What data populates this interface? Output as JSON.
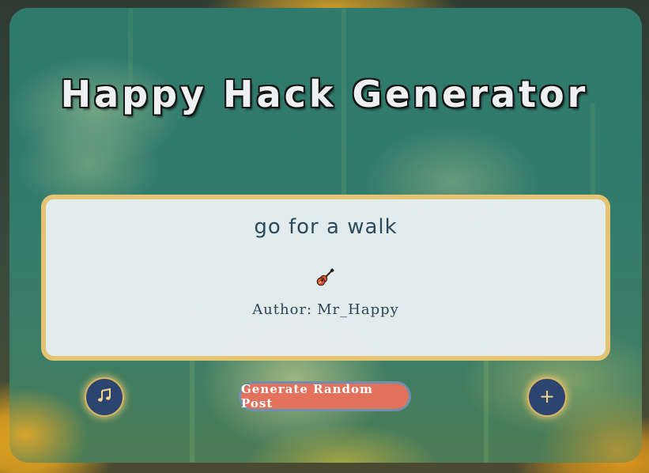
{
  "app": {
    "title": "Happy Hack Generator"
  },
  "post": {
    "text": "go for a walk",
    "category_icon": "guitar-icon",
    "author_label": "Author:",
    "author_name": "Mr_Happy"
  },
  "controls": {
    "music_button_icon": "music-note-icon",
    "generate_label": "Generate Random Post",
    "add_button_icon": "plus-icon",
    "add_button_glyph": "+"
  },
  "colors": {
    "card_border": "#e4c373",
    "button_navy": "#2c4470",
    "generate_button": "#e2725b",
    "text_dark": "#2b4a5e"
  }
}
